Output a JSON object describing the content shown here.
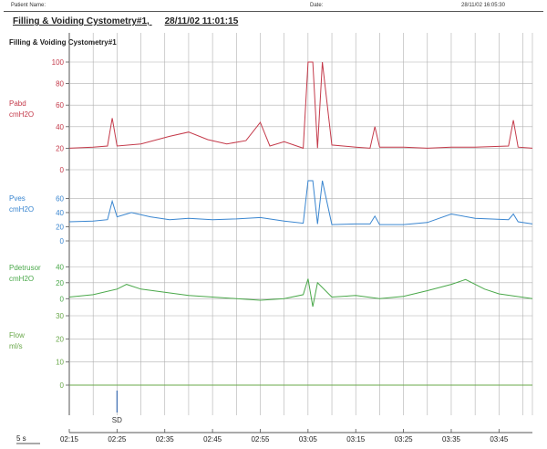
{
  "header": {
    "patient_label": "Patient Name:",
    "date_label": "Date:",
    "datetime": "28/11/02 16:05:30"
  },
  "title": "Filling & Voiding Cystometry#1,",
  "title_datetime": "28/11/02 11:01:15",
  "subtitle": "Filling & Voiding Cystometry#1",
  "scale_label": "5 s",
  "colors": {
    "pabd": "#c43a4a",
    "pves": "#3a86d0",
    "pdet": "#4aa84a",
    "flow": "#6aa84a",
    "marker": "#3a6ab0",
    "grid": "#b0b0b0"
  },
  "chart_data": {
    "type": "line",
    "x_ticks": [
      "02:15",
      "02:25",
      "02:35",
      "02:45",
      "02:55",
      "03:05",
      "03:15",
      "03:25",
      "03:35",
      "03:45"
    ],
    "x_range": [
      "02:15",
      "03:52"
    ],
    "grid": true,
    "channels": [
      {
        "name": "Pabd",
        "unit": "cmH2O",
        "color": "#c43a4a",
        "y_ticks": [
          0,
          20,
          40,
          60,
          80,
          100
        ],
        "ylim": [
          0,
          100
        ],
        "x": [
          "02:15",
          "02:20",
          "02:23",
          "02:24",
          "02:25",
          "02:30",
          "02:36",
          "02:40",
          "02:44",
          "02:48",
          "02:52",
          "02:55",
          "02:57",
          "03:00",
          "03:04",
          "03:05",
          "03:06",
          "03:07",
          "03:08",
          "03:10",
          "03:15",
          "03:18",
          "03:19",
          "03:20",
          "03:25",
          "03:30",
          "03:35",
          "03:40",
          "03:47",
          "03:48",
          "03:49",
          "03:52"
        ],
        "values": [
          20,
          21,
          22,
          48,
          22,
          24,
          31,
          35,
          28,
          24,
          27,
          44,
          22,
          26,
          20,
          100,
          100,
          20,
          100,
          23,
          21,
          20,
          40,
          21,
          21,
          20,
          21,
          21,
          22,
          46,
          21,
          20
        ]
      },
      {
        "name": "Pves",
        "unit": "cmH2O",
        "color": "#3a86d0",
        "y_ticks": [
          0,
          20,
          40,
          60
        ],
        "ylim": [
          0,
          85
        ],
        "x": [
          "02:15",
          "02:20",
          "02:23",
          "02:24",
          "02:25",
          "02:28",
          "02:32",
          "02:36",
          "02:40",
          "02:45",
          "02:50",
          "02:55",
          "03:00",
          "03:04",
          "03:05",
          "03:06",
          "03:07",
          "03:08",
          "03:10",
          "03:15",
          "03:18",
          "03:19",
          "03:20",
          "03:25",
          "03:30",
          "03:35",
          "03:40",
          "03:47",
          "03:48",
          "03:49",
          "03:52"
        ],
        "values": [
          27,
          28,
          30,
          56,
          34,
          40,
          34,
          30,
          32,
          30,
          31,
          33,
          28,
          25,
          85,
          85,
          24,
          85,
          23,
          24,
          24,
          35,
          23,
          23,
          26,
          38,
          32,
          30,
          38,
          27,
          24
        ]
      },
      {
        "name": "Pdetrusor",
        "unit": "cmH2O",
        "color": "#4aa84a",
        "y_ticks": [
          0,
          20,
          40
        ],
        "ylim": [
          -10,
          45
        ],
        "x": [
          "02:15",
          "02:20",
          "02:25",
          "02:27",
          "02:30",
          "02:35",
          "02:40",
          "02:45",
          "02:50",
          "02:55",
          "03:00",
          "03:04",
          "03:05",
          "03:06",
          "03:07",
          "03:10",
          "03:15",
          "03:20",
          "03:25",
          "03:30",
          "03:35",
          "03:38",
          "03:42",
          "03:45",
          "03:52"
        ],
        "values": [
          2,
          5,
          12,
          18,
          12,
          8,
          4,
          2,
          0,
          -2,
          0,
          5,
          25,
          -10,
          20,
          2,
          4,
          0,
          3,
          10,
          18,
          24,
          12,
          6,
          0
        ]
      },
      {
        "name": "Flow",
        "unit": "ml/s",
        "color": "#6aa84a",
        "y_ticks": [
          0,
          10,
          20,
          30
        ],
        "ylim": [
          0,
          30
        ],
        "x": [
          "02:15",
          "03:52"
        ],
        "values": [
          0,
          0
        ]
      }
    ],
    "annotations": [
      {
        "x": "02:25",
        "label": "SD"
      }
    ]
  }
}
